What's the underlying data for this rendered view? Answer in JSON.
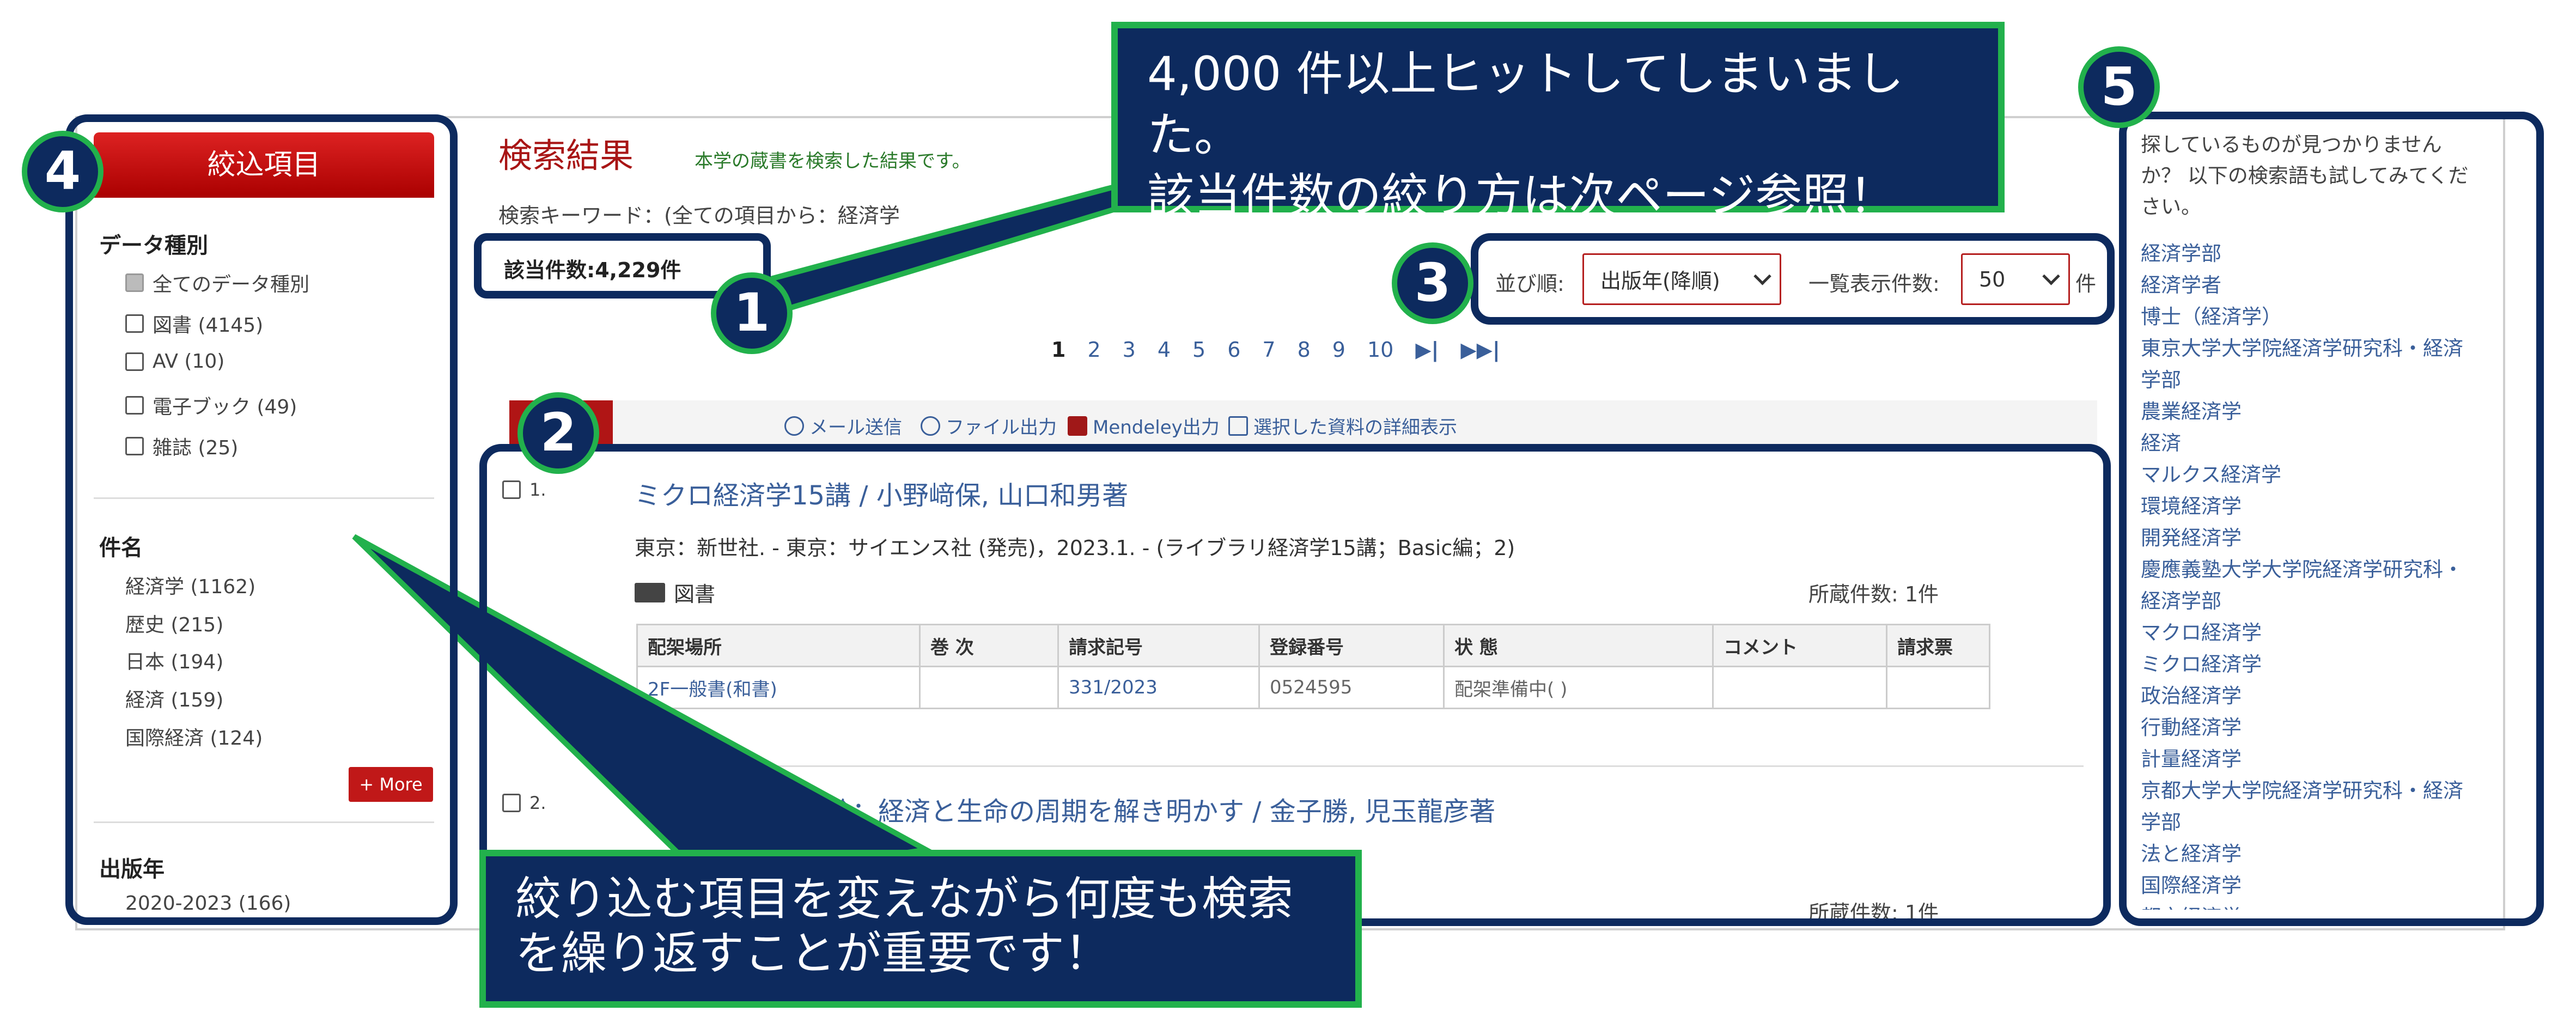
{
  "sidebar": {
    "header": "絞込項目",
    "data_type_title": "データ種別",
    "data_types": [
      {
        "label": "全てのデータ種別",
        "checked": true
      },
      {
        "label": "図書 (4145)",
        "checked": false
      },
      {
        "label": "AV (10)",
        "checked": false
      },
      {
        "label": "電子ブック (49)",
        "checked": false
      },
      {
        "label": "雑誌 (25)",
        "checked": false
      }
    ],
    "title_title": "件名",
    "title_facets": [
      "経済学 (1162)",
      "歴史 (215)",
      "日本 (194)",
      "経済 (159)",
      "国際経済 (124)"
    ],
    "more_label": "+ More",
    "year_title": "出版年",
    "year_facets": [
      "2020-2023 (166)"
    ]
  },
  "main": {
    "title": "検索結果",
    "subtitle": "本学の蔵書を検索した結果です。",
    "keyword_line": "検索キーワード：(全ての項目から：経済学",
    "count": "該当件数:4,229件",
    "pages": [
      "1",
      "2",
      "3",
      "4",
      "5",
      "6",
      "7",
      "8",
      "9",
      "10"
    ],
    "next_icon": "next-page-icon",
    "last_icon": "last-page-icon",
    "sort_label": "並び順:",
    "sort_value": "出版年(降順)",
    "per_page_label": "一覧表示件数:",
    "per_page_value": "50",
    "per_page_unit": "件",
    "tools": [
      "メール送信",
      "ファイル出力",
      "Mendeley出力",
      "選択した資料の詳細表示"
    ],
    "results": [
      {
        "index": "1.",
        "title": "ミクロ経済学15講 / 小野﨑保, 山口和男著",
        "pub": "東京：新世社. - 東京：サイエンス社 (発売)，2023.1. - (ライブラリ経済学15講；Basic編；2)",
        "type": "図書",
        "holdings": "所蔵件数: 1件",
        "table_headers": [
          "配架場所",
          "巻 次",
          "請求記号",
          "登録番号",
          "状 態",
          "コメント",
          "請求票"
        ],
        "table_row": [
          "2F一般書(和書)",
          "",
          "331/2023",
          "0524595",
          "配架準備中( )",
          "",
          ""
        ]
      },
      {
        "index": "2.",
        "title": "ロフ論：経済と生命の周期を解き明かす / 金子勝, 児玉龍彦著",
        "holdings": "所蔵件数: 1件"
      }
    ]
  },
  "right_panel": {
    "intro": [
      "探しているものが見つかりません",
      "か？ 以下の検索語も試してみてくだ",
      "さい。"
    ],
    "terms": [
      "経済学部",
      "経済学者",
      "博士（経済学）",
      "東京大学大学院経済学研究科・経済",
      "学部",
      "農業経済学",
      "経済",
      "マルクス経済学",
      "環境経済学",
      "開発経済学",
      "慶應義塾大学大学院経済学研究科・",
      "経済学部",
      "マクロ経済学",
      "ミクロ経済学",
      "政治経済学",
      "行動経済学",
      "計量経済学",
      "京都大学大学院経済学研究科・経済",
      "学部",
      "法と経済学",
      "国際経済学",
      "都市経済学"
    ]
  },
  "annotations": {
    "n1": "1",
    "n2": "2",
    "n3": "3",
    "n4": "4",
    "n5": "5",
    "callout_top": [
      "4,000 件以上ヒットしてしまいました。",
      "該当件数の絞り方は次ページ参照！"
    ],
    "callout_bottom": [
      "絞り込む項目を変えながら何度も検索",
      "を繰り返すことが重要です！"
    ]
  },
  "colors": {
    "navy": "#0d2a5e",
    "green": "#22b14c",
    "red": "#c01818",
    "link": "#3a5f9a"
  }
}
